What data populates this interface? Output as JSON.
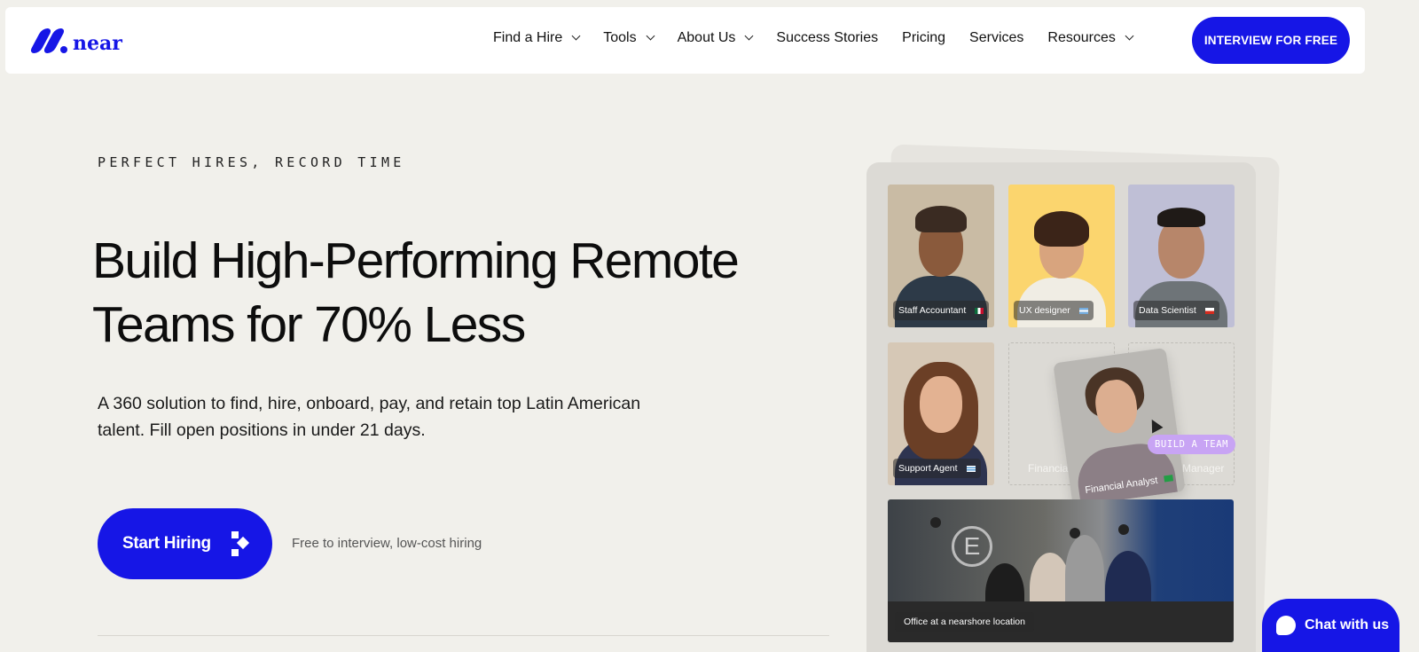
{
  "brand": {
    "name": "near",
    "color": "#1616e6"
  },
  "nav": {
    "items": [
      {
        "label": "Find a Hire",
        "has_dropdown": true
      },
      {
        "label": "Tools",
        "has_dropdown": true
      },
      {
        "label": "About Us",
        "has_dropdown": true
      },
      {
        "label": "Success Stories",
        "has_dropdown": false
      },
      {
        "label": "Pricing",
        "has_dropdown": false
      },
      {
        "label": "Services",
        "has_dropdown": false
      },
      {
        "label": "Resources",
        "has_dropdown": true
      }
    ],
    "cta_label": "INTERVIEW FOR FREE"
  },
  "hero": {
    "eyebrow": "PERFECT HIRES, RECORD TIME",
    "headline": "Build High-Performing Remote Teams for 70% Less",
    "subtext": "A 360 solution to find, hire, onboard, pay, and retain top Latin American talent. Fill open positions in under 21 days.",
    "primary_button": "Start Hiring",
    "hint": "Free to interview, low-cost hiring"
  },
  "team_panel": {
    "cards": [
      {
        "role": "Staff Accountant",
        "flag": "mexico-flag"
      },
      {
        "role": "UX designer",
        "flag": "argentina-flag"
      },
      {
        "role": "Data Scientist",
        "flag": "chile-flag"
      },
      {
        "role": "Support Agent",
        "flag": "uruguay-flag"
      }
    ],
    "empty_slots": [
      "Financial",
      "Manager"
    ],
    "dragged_card": {
      "role": "Financial Analyst",
      "flag": "brazil-flag"
    },
    "build_badge": "BUILD A TEAM",
    "office_caption": "Office at a nearshore location"
  },
  "chat": {
    "label": "Chat with us"
  }
}
